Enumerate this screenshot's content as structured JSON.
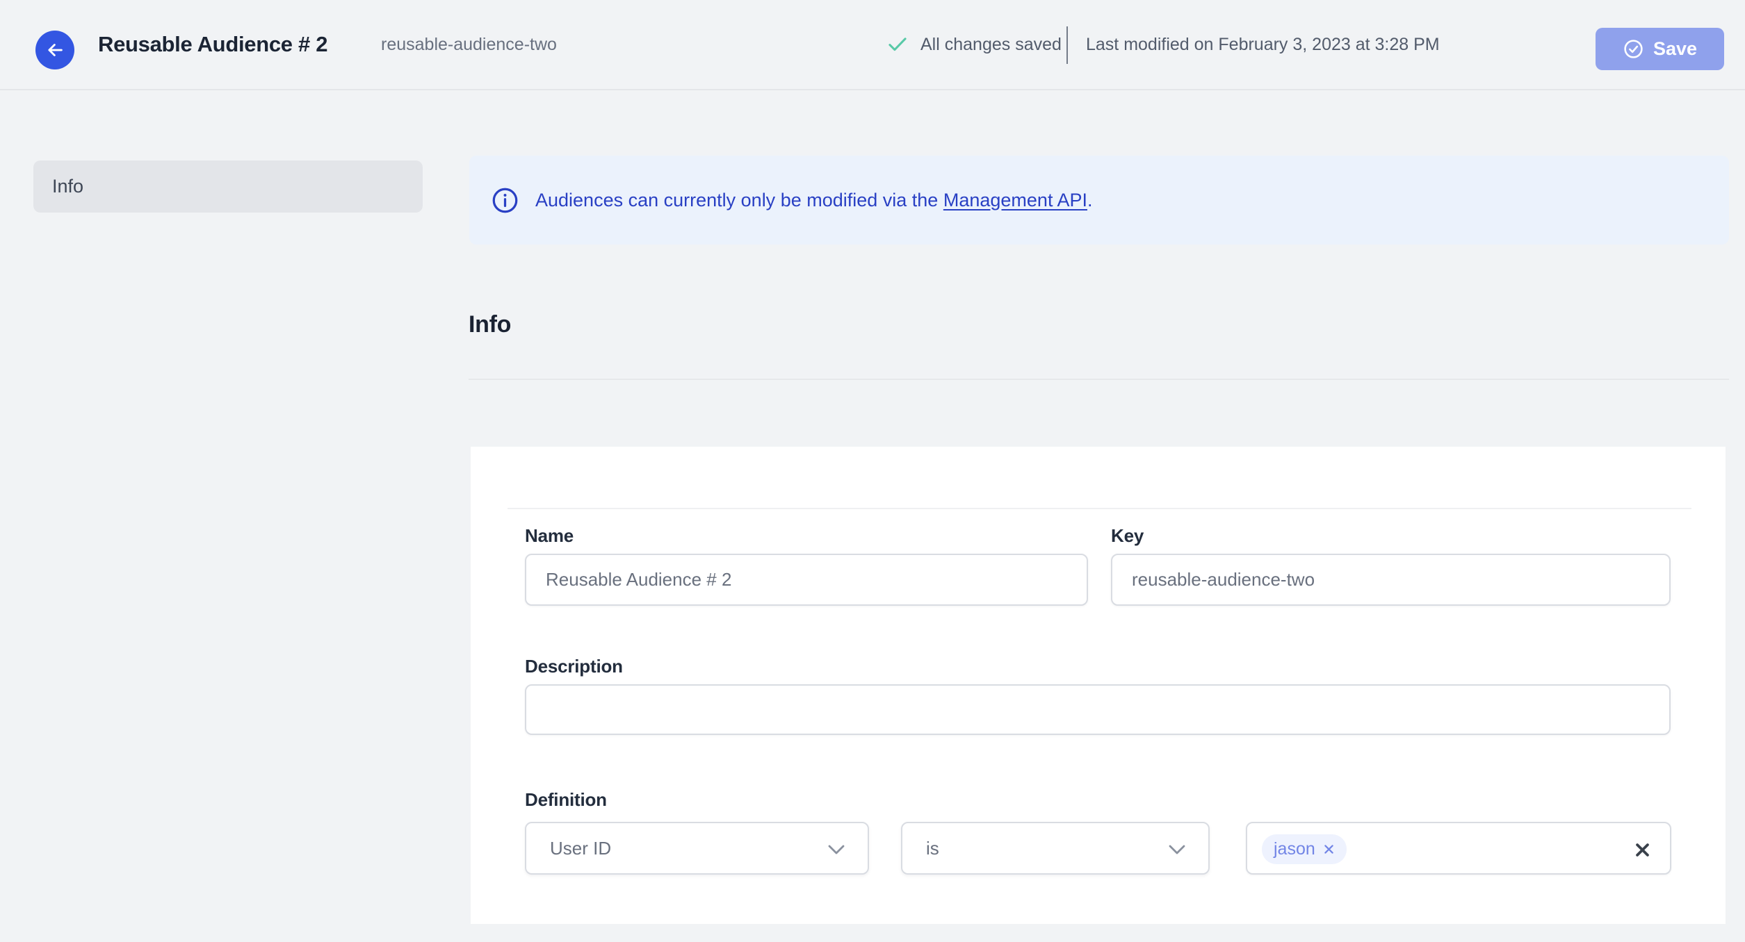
{
  "header": {
    "title": "Reusable Audience # 2",
    "subtitle": "reusable-audience-two",
    "status_text": "All changes saved",
    "last_modified": "Last modified on February 3, 2023 at 3:28 PM",
    "save_label": "Save"
  },
  "sidebar": {
    "items": [
      {
        "label": "Info",
        "active": true
      }
    ]
  },
  "banner": {
    "text": "Audiences can currently only be modified via the",
    "link_text": "Management API",
    "suffix": "."
  },
  "main": {
    "section_heading": "Info"
  },
  "form": {
    "name": {
      "label": "Name",
      "value": "Reusable Audience # 2"
    },
    "key": {
      "label": "Key",
      "value": "reusable-audience-two"
    },
    "description": {
      "label": "Description",
      "value": ""
    },
    "definition": {
      "label": "Definition",
      "field_selected": "User ID",
      "operator_selected": "is",
      "tags": [
        "jason"
      ]
    }
  },
  "icons": {
    "back": "arrow-left-icon",
    "saved": "check-icon",
    "save": "circle-check-icon",
    "banner": "info-circle-icon",
    "dropdown": "chevron-down-icon",
    "chip_remove": "x-icon",
    "clear_values": "x-icon"
  },
  "colors": {
    "accent_blue": "#3356E2",
    "banner_bg": "#EBF2FC",
    "banner_text_blue": "#2940C4",
    "success_green": "#58C9A7",
    "save_button_bg": "#8FA1EC",
    "chip_bg": "#EEF2FE",
    "chip_text": "#7285E6",
    "page_bg": "#F1F3F5",
    "card_bg": "#FFFFFF"
  }
}
